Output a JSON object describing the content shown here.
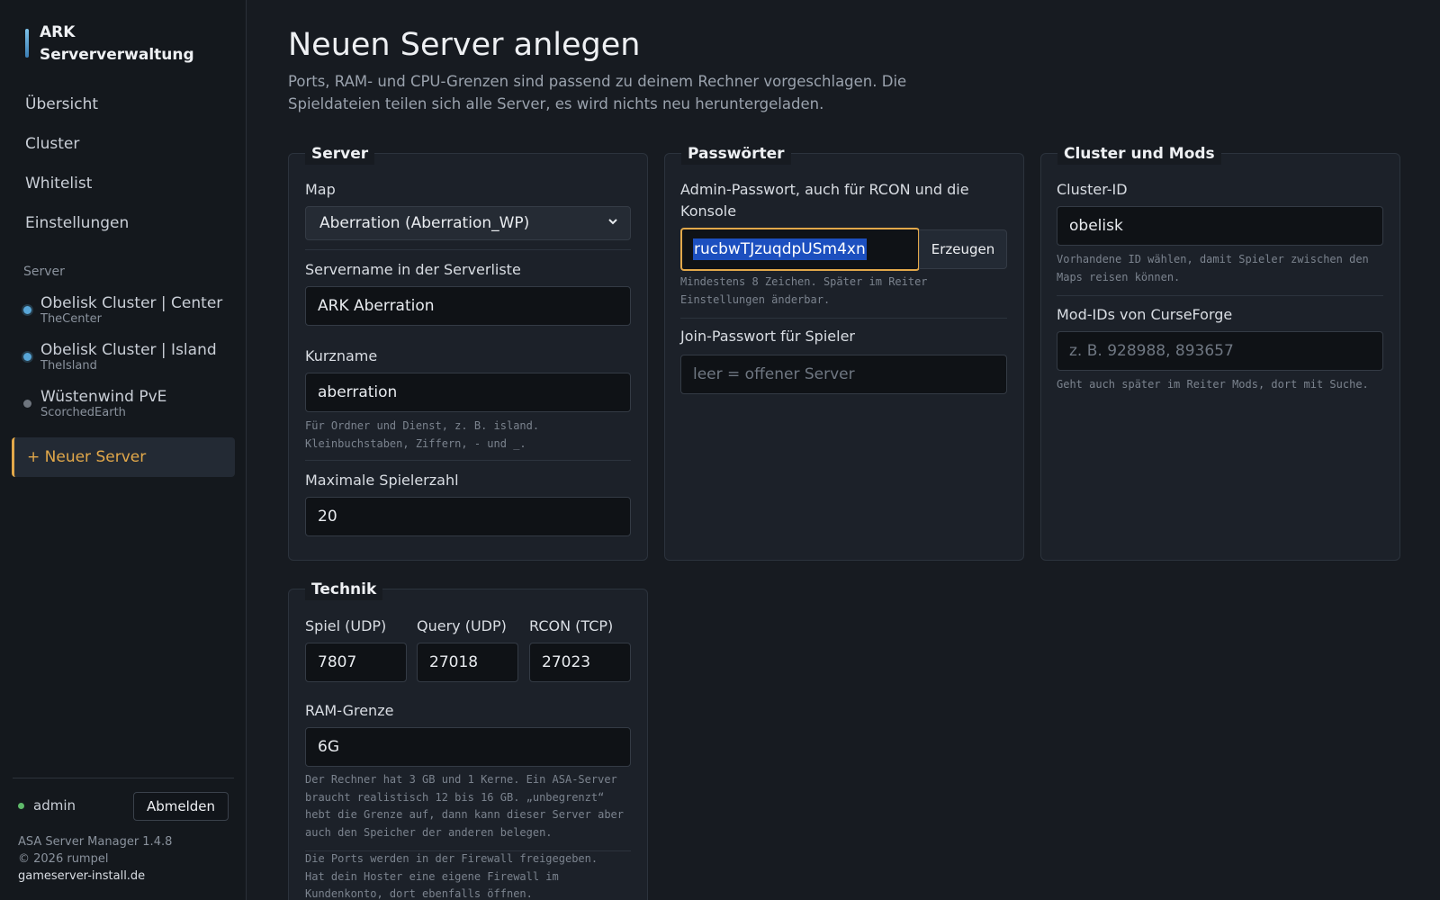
{
  "sidebar": {
    "brand": "ARK Serververwaltung",
    "nav": [
      {
        "label": "Übersicht"
      },
      {
        "label": "Cluster"
      },
      {
        "label": "Whitelist"
      },
      {
        "label": "Einstellungen"
      }
    ],
    "section_label": "Server",
    "servers": [
      {
        "name": "Obelisk Cluster | Center",
        "map": "TheCenter",
        "status": "blue"
      },
      {
        "name": "Obelisk Cluster | Island",
        "map": "TheIsland",
        "status": "blue"
      },
      {
        "name": "Wüstenwind PvE",
        "map": "ScorchedEarth",
        "status": "grey"
      }
    ],
    "new_server": "+ Neuer Server",
    "user": "admin",
    "logout": "Abmelden",
    "footer": {
      "version": "ASA Server Manager 1.4.8",
      "copyright": "© 2026 rumpel",
      "link": "gameserver-install.de"
    }
  },
  "page": {
    "title": "Neuen Server anlegen",
    "subtitle": "Ports, RAM- und CPU-Grenzen sind passend zu deinem Rechner vorgeschlagen. Die Spieldateien teilen sich alle Server, es wird nichts neu heruntergeladen."
  },
  "server_card": {
    "title": "Server",
    "map_label": "Map",
    "map_value": "Aberration (Aberration_WP)",
    "name_label": "Servername in der Serverliste",
    "name_value": "ARK Aberration",
    "short_label": "Kurzname",
    "short_value": "aberration",
    "short_help": "Für Ordner und Dienst, z. B. island. Kleinbuchstaben, Ziffern, - und _.",
    "players_label": "Maximale Spielerzahl",
    "players_value": "20"
  },
  "password_card": {
    "title": "Passwörter",
    "admin_label": "Admin-Passwort, auch für RCON und die Konsole",
    "admin_value": "rucbwTJzuqdpUSm4xn",
    "generate": "Erzeugen",
    "admin_help": "Mindestens 8 Zeichen. Später im Reiter Einstellungen änderbar.",
    "join_label": "Join-Passwort für Spieler",
    "join_placeholder": "leer = offener Server"
  },
  "cluster_card": {
    "title": "Cluster und Mods",
    "cluster_label": "Cluster-ID",
    "cluster_value": "obelisk",
    "cluster_help": "Vorhandene ID wählen, damit Spieler zwischen den Maps reisen können.",
    "mods_label": "Mod-IDs von CurseForge",
    "mods_placeholder": "z. B. 928988, 893657",
    "mods_help": "Geht auch später im Reiter Mods, dort mit Suche."
  },
  "tech_card": {
    "title": "Technik",
    "game_label": "Spiel (UDP)",
    "game_value": "7807",
    "query_label": "Query (UDP)",
    "query_value": "27018",
    "rcon_label": "RCON (TCP)",
    "rcon_value": "27023",
    "ram_label": "RAM-Grenze",
    "ram_value": "6G",
    "ram_help": "Der Rechner hat 3 GB und 1 Kerne. Ein ASA-Server braucht realistisch 12 bis 16 GB. „unbegrenzt“ hebt die Grenze auf, dann kann dieser Server aber auch den Speicher der anderen belegen.",
    "firewall_help": "Die Ports werden in der Firewall freigegeben. Hat dein Hoster eine eigene Firewall im Kundenkonto, dort ebenfalls öffnen."
  }
}
